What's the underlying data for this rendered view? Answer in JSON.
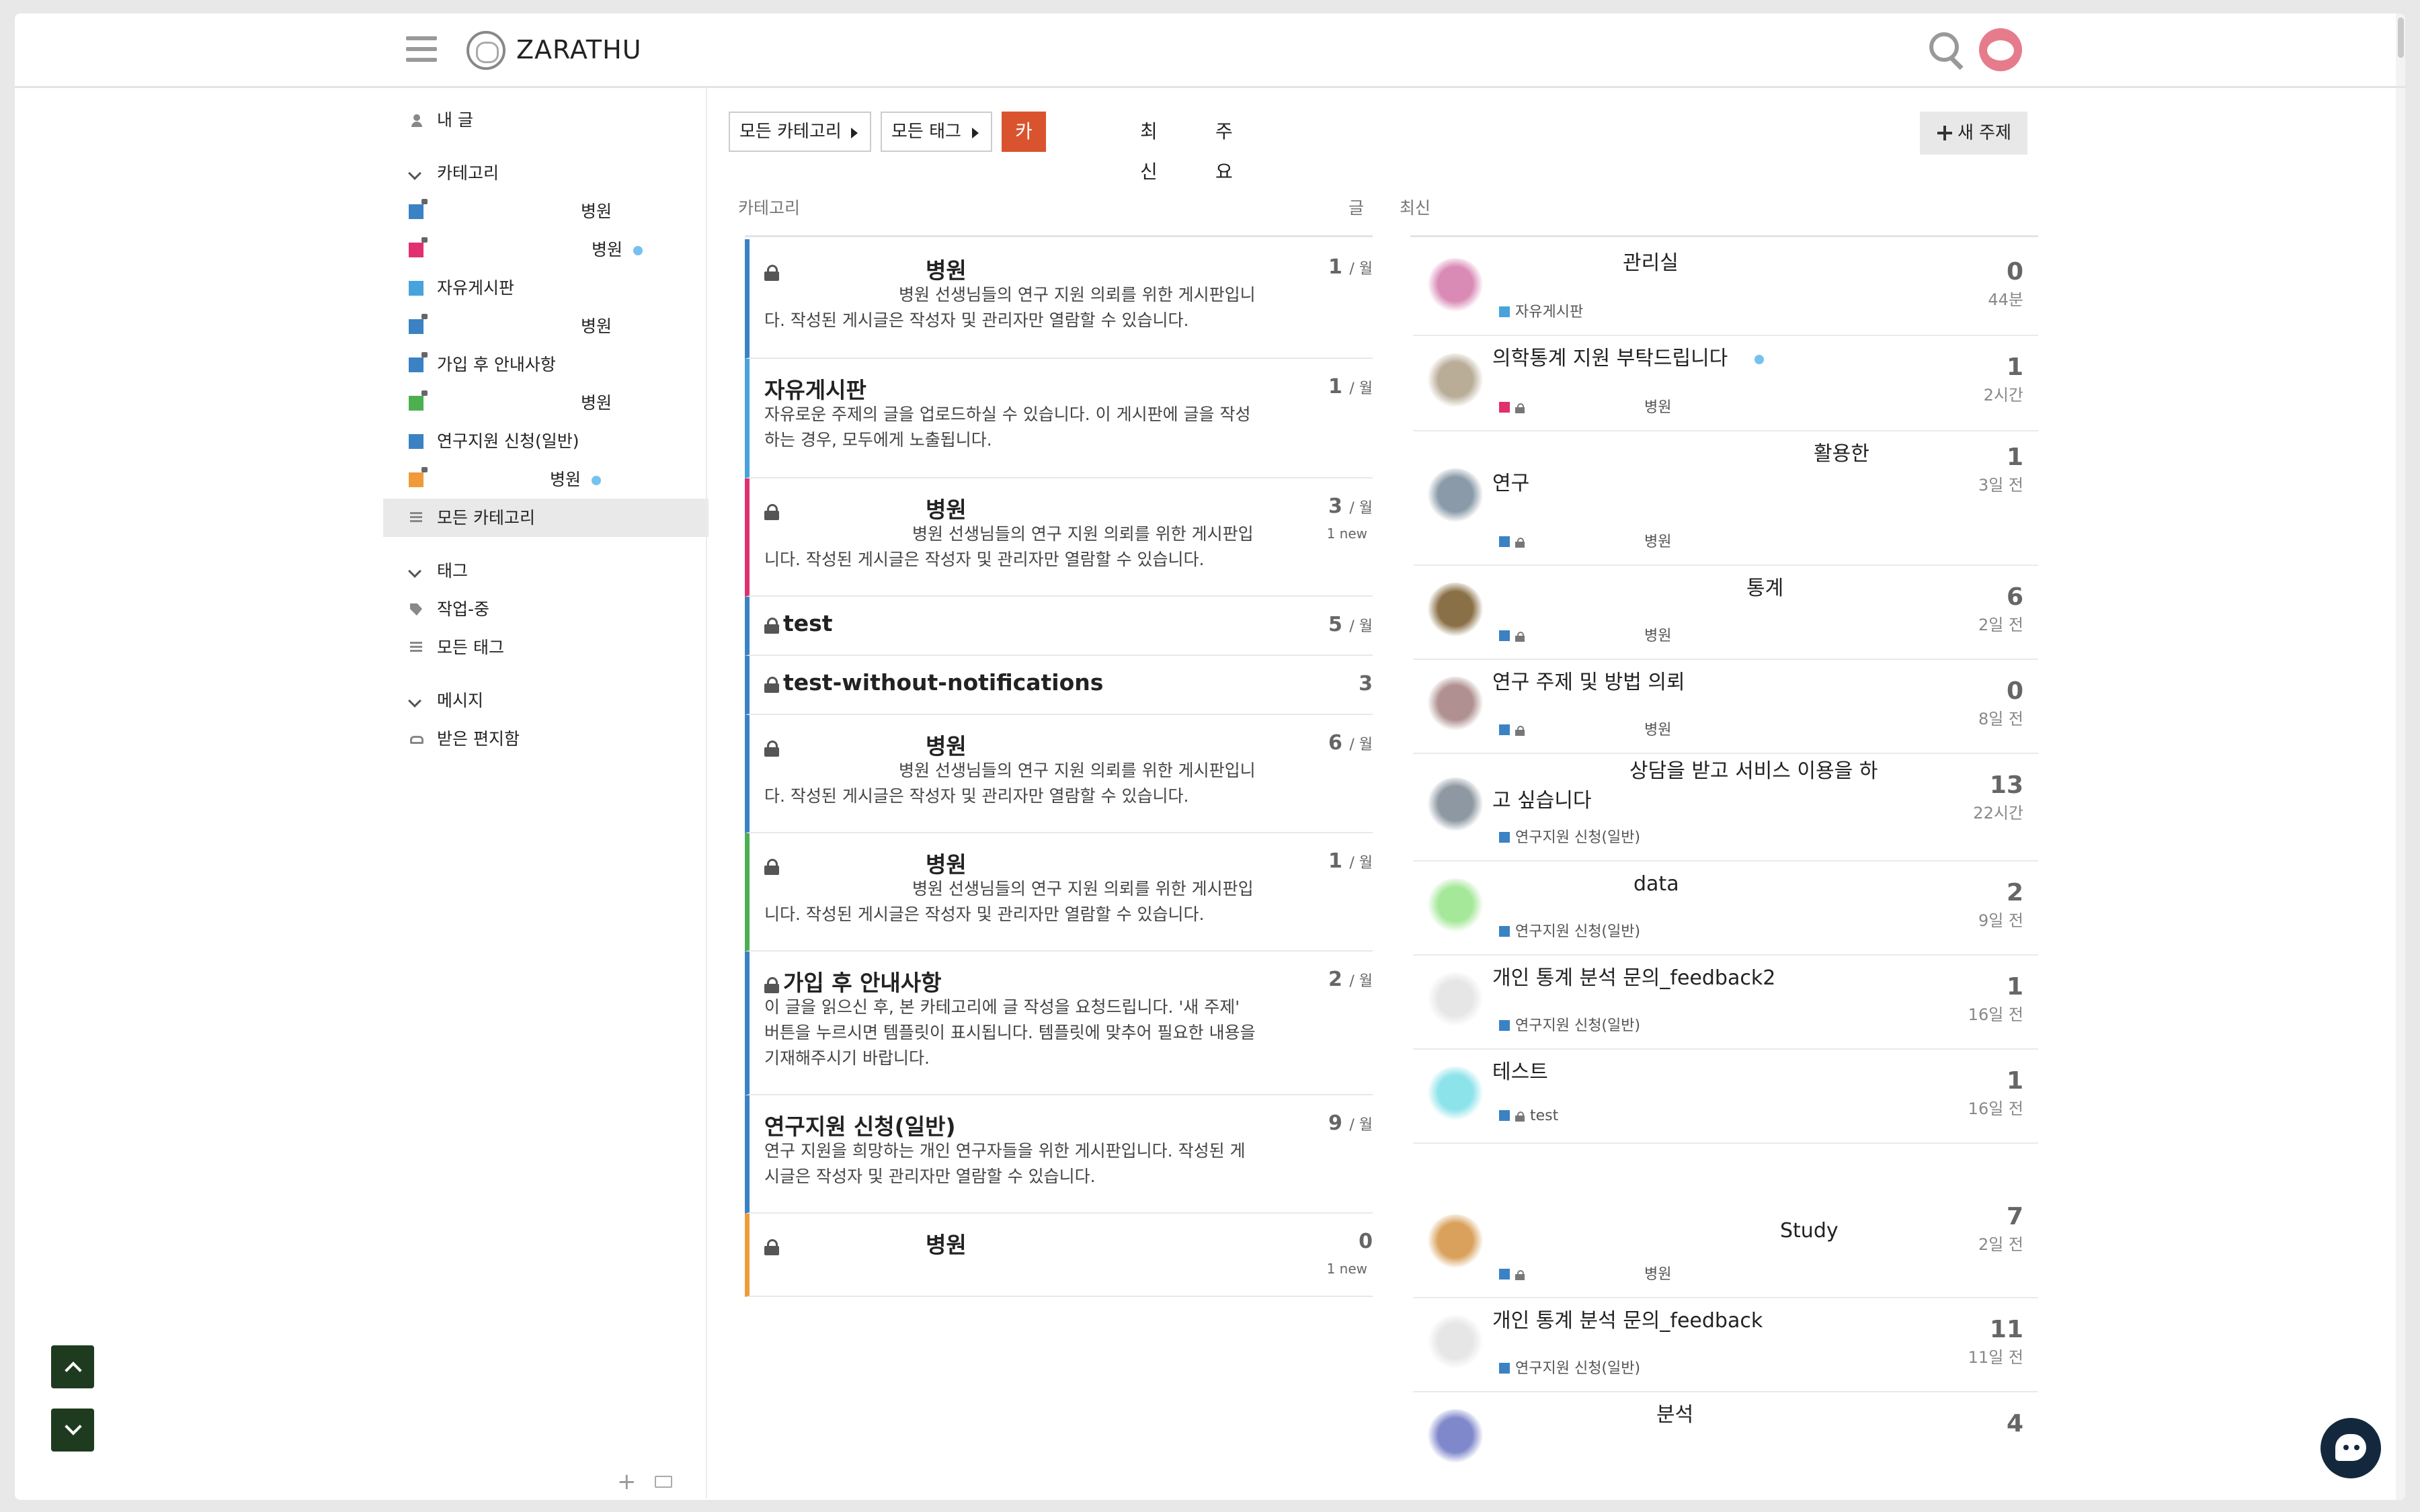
{
  "header": {
    "brand": "ZARATHU"
  },
  "sidebar": {
    "my_posts": "내 글",
    "categories_label": "카테고리",
    "category_items": [
      {
        "label": "병원",
        "color": "#3b82c4",
        "locked": true,
        "dot": false
      },
      {
        "label": "병원",
        "color": "#e0306f",
        "locked": true,
        "dot": true
      },
      {
        "label": "자유게시판",
        "color": "#48a3dc",
        "locked": false,
        "dot": false
      },
      {
        "label": "병원",
        "color": "#3b82c4",
        "locked": true,
        "dot": false
      },
      {
        "label": "가입 후 안내사항",
        "color": "#3b82c4",
        "locked": true,
        "dot": false
      },
      {
        "label": "병원",
        "color": "#4caf50",
        "locked": true,
        "dot": false
      },
      {
        "label": "연구지원 신청(일반)",
        "color": "#3b82c4",
        "locked": false,
        "dot": false
      },
      {
        "label": "병원",
        "color": "#f09b3a",
        "locked": true,
        "dot": true
      }
    ],
    "all_categories": "모든 카테고리",
    "tags_label": "태그",
    "tag_item": "작업-중",
    "all_tags": "모든 태그",
    "messages_label": "메시지",
    "inbox": "받은 편지함"
  },
  "nav": {
    "all_categories_dd": "모든 카테고리",
    "all_tags_dd": "모든 태그",
    "tab_categories": "카테고리",
    "tab_latest": "최신",
    "tab_top": "주요",
    "new_topic": "새 주제"
  },
  "columns": {
    "category": "카테고리",
    "posts": "글",
    "latest": "최신"
  },
  "categories": [
    {
      "name": "병원",
      "locked": true,
      "color": "#3b82c4",
      "desc1": "병원 선생님들의 연구 지원 의뢰를 위한 게시판입니",
      "desc2": "다. 작성된 게시글은 작성자 및 관리자만 열람할 수 있습니다.",
      "count": "1",
      "unit": "/ 월",
      "new": ""
    },
    {
      "name": "자유게시판",
      "locked": false,
      "color": "#48a3dc",
      "desc1": "자유로운 주제의 글을 업로드하실 수 있습니다. 이 게시판에 글을 작성",
      "desc2": "하는 경우, 모두에게 노출됩니다.",
      "count": "1",
      "unit": "/ 월",
      "new": ""
    },
    {
      "name": "병원",
      "locked": true,
      "color": "#e0306f",
      "desc1": "병원 선생님들의 연구 지원 의뢰를 위한 게시판입",
      "desc2": "니다. 작성된 게시글은 작성자 및 관리자만 열람할 수 있습니다.",
      "count": "3",
      "unit": "/ 월",
      "new": "1 new"
    },
    {
      "name": "test",
      "locked": true,
      "color": "#3b82c4",
      "count": "5",
      "unit": "/ 월"
    },
    {
      "name": "test-without-notifications",
      "locked": true,
      "color": "#3b82c4",
      "count": "3",
      "unit": ""
    },
    {
      "name": "병원",
      "locked": true,
      "color": "#3b82c4",
      "desc1": "병원 선생님들의 연구 지원 의뢰를 위한 게시판입니",
      "desc2": "다. 작성된 게시글은 작성자 및 관리자만 열람할 수 있습니다.",
      "count": "6",
      "unit": "/ 월"
    },
    {
      "name": "병원",
      "locked": true,
      "color": "#4caf50",
      "desc1": "병원 선생님들의 연구 지원 의뢰를 위한 게시판입",
      "desc2": "니다. 작성된 게시글은 작성자 및 관리자만 열람할 수 있습니다.",
      "count": "1",
      "unit": "/ 월"
    },
    {
      "name": "가입 후 안내사항",
      "locked": true,
      "color": "#3b82c4",
      "desc1": "이 글을 읽으신 후, 본 카테고리에 글 작성을 요청드립니다. '새 주제'",
      "desc2": "버튼을 누르시면 템플릿이 표시됩니다. 템플릿에 맞추어 필요한 내용을",
      "desc3": "기재해주시기 바랍니다.",
      "count": "2",
      "unit": "/ 월"
    },
    {
      "name": "연구지원 신청(일반)",
      "locked": false,
      "color": "#3b82c4",
      "desc1": "연구 지원을 희망하는 개인 연구자들을 위한 게시판입니다. 작성된 게",
      "desc2": "시글은 작성자 및 관리자만 열람할 수 있습니다.",
      "count": "9",
      "unit": "/ 월"
    },
    {
      "name": "병원",
      "locked": true,
      "color": "#f09b3a",
      "count": "0",
      "unit": "",
      "new": "1 new"
    }
  ],
  "topics": [
    {
      "title": "관리실",
      "category": "자유게시판",
      "cat_color": "#48a3dc",
      "locked": false,
      "count": "0",
      "age": "44분",
      "avatar": "#d98ab5"
    },
    {
      "title": "의학통계 지원 부탁드립니다",
      "category": "병원",
      "cat_color": "#e0306f",
      "locked": true,
      "count": "1",
      "age": "2시간",
      "avatar": "#b9ad98"
    },
    {
      "title": "활용한",
      "title2": "연구",
      "category": "병원",
      "cat_color": "#3b82c4",
      "locked": true,
      "count": "1",
      "age": "3일 전",
      "avatar": "#8a9aa8"
    },
    {
      "title": "통계",
      "category": "병원",
      "cat_color": "#3b82c4",
      "locked": true,
      "count": "6",
      "age": "2일 전",
      "avatar": "#8a7047"
    },
    {
      "title": "연구 주제 및 방법 의뢰",
      "category": "병원",
      "cat_color": "#3b82c4",
      "locked": true,
      "count": "0",
      "age": "8일 전",
      "avatar": "#b09090"
    },
    {
      "title": "상담을 받고 서비스 이용을 하",
      "title2": "고 싶습니다",
      "category": "연구지원 신청(일반)",
      "cat_color": "#3b82c4",
      "locked": false,
      "count": "13",
      "age": "22시간",
      "avatar": "#8d98a2"
    },
    {
      "title": "data",
      "category": "연구지원 신청(일반)",
      "cat_color": "#3b82c4",
      "locked": false,
      "count": "2",
      "age": "9일 전",
      "avatar": "#a6e89a"
    },
    {
      "title": "개인 통계 분석 문의_feedback2",
      "category": "연구지원 신청(일반)",
      "cat_color": "#3b82c4",
      "locked": false,
      "count": "1",
      "age": "16일 전",
      "avatar": "#e6e6e6"
    },
    {
      "title": "테스트",
      "category": "test",
      "cat_color": "#3b82c4",
      "locked": true,
      "count": "1",
      "age": "16일 전",
      "avatar": "#8de3ea"
    },
    {
      "title": "Study",
      "category": "병원",
      "cat_color": "#3b82c4",
      "locked": true,
      "count": "7",
      "age": "2일 전",
      "avatar": "#d9a15c"
    },
    {
      "title": "개인 통계 분석 문의_feedback",
      "category": "연구지원 신청(일반)",
      "cat_color": "#3b82c4",
      "locked": false,
      "count": "11",
      "age": "11일 전",
      "avatar": "#e6e6e6"
    },
    {
      "title": "분석",
      "count": "4",
      "avatar": "#8088cc"
    }
  ]
}
